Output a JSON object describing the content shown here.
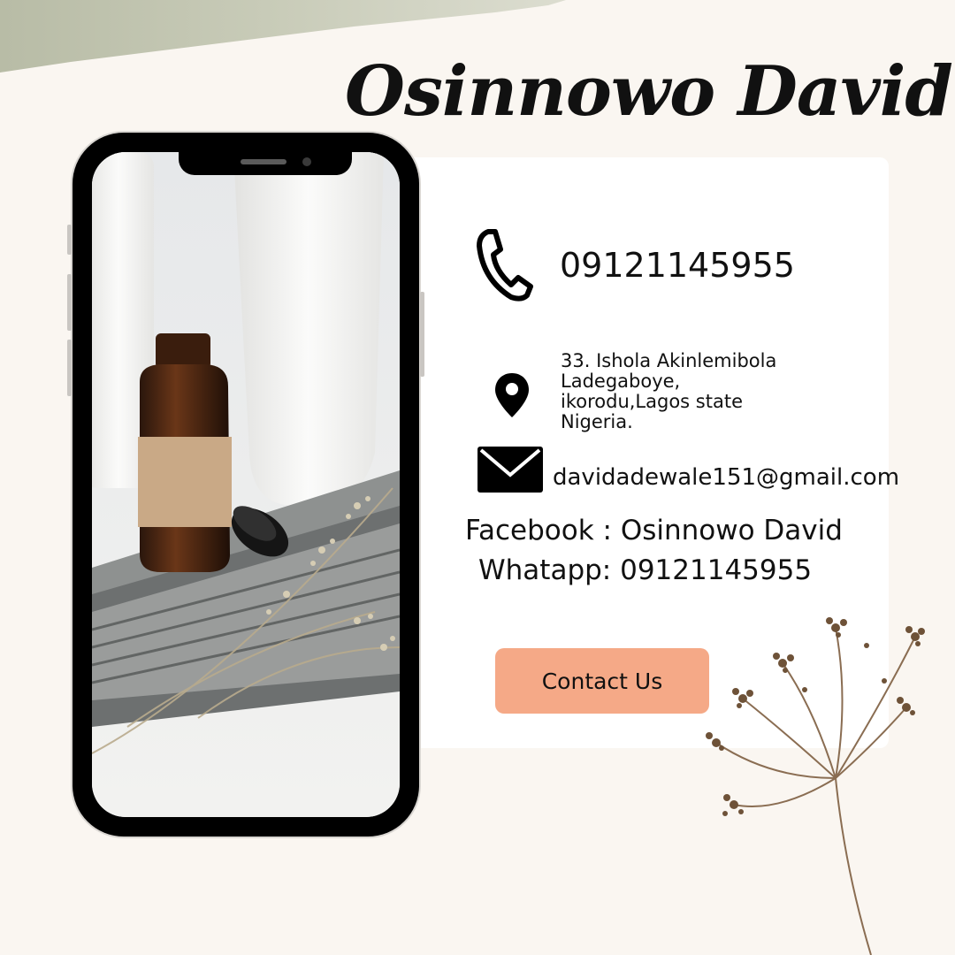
{
  "title": "Osinnowo David",
  "contact": {
    "phone": "09121145955",
    "address_lines": [
      "33. Ishola Akinlemibola",
      "Ladegaboye,",
      "ikorodu,Lagos state",
      "Nigeria."
    ],
    "email": "davidadewale151@gmail.com",
    "facebook": "Facebook : Osinnowo David",
    "whatsapp": "Whatapp: 09121145955"
  },
  "button": {
    "label": "Contact Us"
  },
  "colors": {
    "background": "#faf6f1",
    "card": "#ffffff",
    "button": "#f5a987",
    "text": "#111111"
  },
  "icons": [
    "phone-icon",
    "location-pin-icon",
    "envelope-icon"
  ]
}
